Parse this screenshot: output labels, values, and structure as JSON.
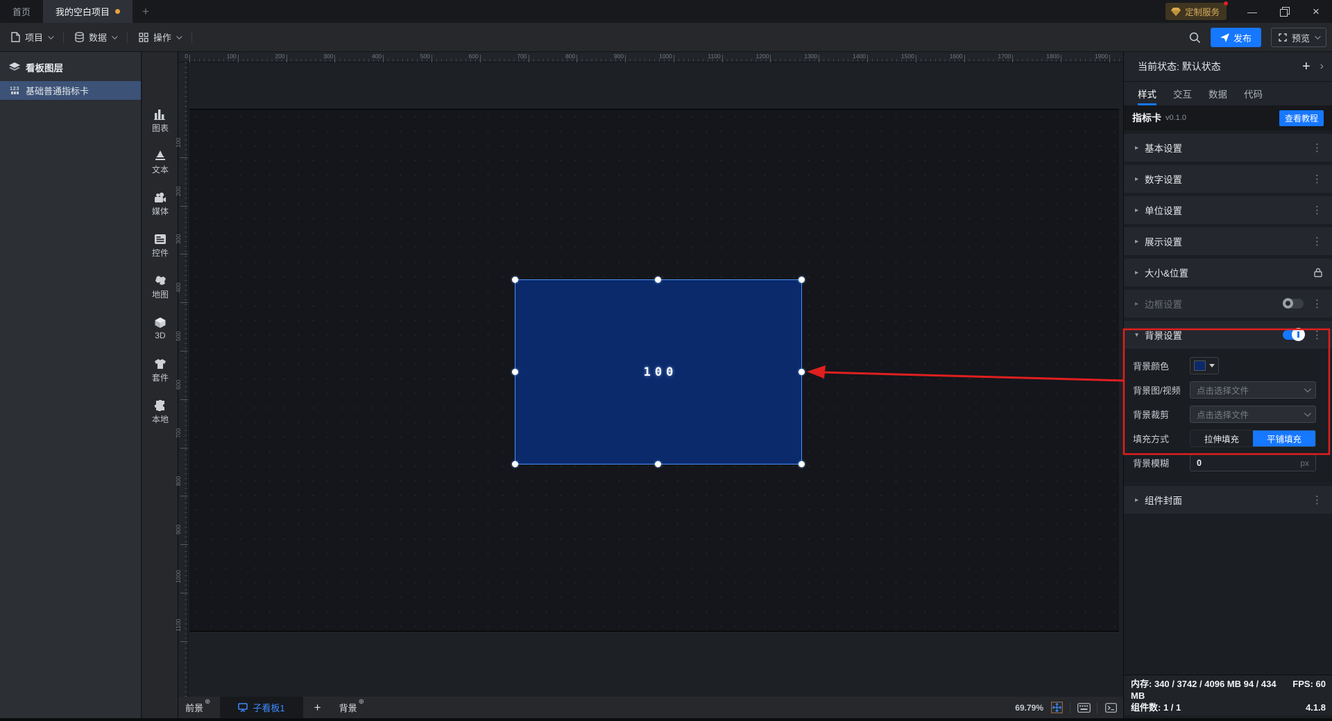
{
  "titlebar": {
    "tabs": [
      {
        "label": "首页"
      },
      {
        "label": "我的空白项目"
      }
    ],
    "custom_service": "定制服务"
  },
  "toolbar": {
    "menus": [
      {
        "label": "项目"
      },
      {
        "label": "数据"
      },
      {
        "label": "操作"
      }
    ],
    "publish": "发布",
    "preview": "预览"
  },
  "layers": {
    "title": "看板图层",
    "items": [
      {
        "label": "基础普通指标卡",
        "selected": true
      }
    ]
  },
  "dock": {
    "items": [
      {
        "label": "图表"
      },
      {
        "label": "文本"
      },
      {
        "label": "媒体"
      },
      {
        "label": "控件"
      },
      {
        "label": "地图"
      },
      {
        "label": "3D"
      },
      {
        "label": "套件"
      },
      {
        "label": "本地"
      }
    ]
  },
  "canvas": {
    "indicator_value": "100",
    "zoom_percent": "69.79%",
    "h_ruler_labels": [
      "0",
      "100",
      "200",
      "300",
      "400",
      "500",
      "600",
      "700",
      "800",
      "900",
      "1000",
      "1100",
      "1200",
      "1300",
      "1400",
      "1500",
      "1600",
      "1700",
      "1800",
      "1900"
    ],
    "v_ruler_labels": [
      "100",
      "200",
      "300",
      "400",
      "500",
      "600",
      "700",
      "800",
      "900",
      "1000",
      "1100"
    ]
  },
  "bottom_bar": {
    "foreground": "前景",
    "board_tab": "子看板1",
    "add": "+",
    "background": "背景"
  },
  "inspector": {
    "state_label": "当前状态: 默认状态",
    "tabs": [
      {
        "label": "样式"
      },
      {
        "label": "交互"
      },
      {
        "label": "数据"
      },
      {
        "label": "代码"
      }
    ],
    "component": {
      "name": "指标卡",
      "version": "v0.1.0",
      "tutorial": "查看教程"
    },
    "sections": [
      {
        "label": "基本设置"
      },
      {
        "label": "数字设置"
      },
      {
        "label": "单位设置"
      },
      {
        "label": "展示设置"
      },
      {
        "label": "大小&位置"
      },
      {
        "label": "边框设置"
      },
      {
        "label": "背景设置"
      },
      {
        "label": "组件封面"
      }
    ],
    "background_settings": {
      "color_label": "背景颜色",
      "image_label": "背景图/视频",
      "image_value": "点击选择文件",
      "crop_label": "背景裁剪",
      "crop_value": "点击选择文件",
      "fill_label": "填充方式",
      "fill_options": [
        {
          "label": "拉伸填充"
        },
        {
          "label": "平铺填充"
        }
      ],
      "fill_selected": "平铺填充",
      "blur_label": "背景模糊",
      "blur_value": "0",
      "blur_suffix": "px"
    }
  },
  "status_bar": {
    "memory_label": "内存:",
    "memory_value": "340 / 3742 / 4096 MB  94 / 434 MB",
    "fps_label": "FPS:",
    "fps_value": "60",
    "components_label": "组件数:",
    "components_value": "1 / 1",
    "version": "4.1.8"
  },
  "colors": {
    "accent": "#1677ff",
    "selection": "#4a90ff",
    "annotation": "#e01f1f",
    "shape_fill": "#0a2a6b",
    "modified_dot": "#e8a33d"
  }
}
